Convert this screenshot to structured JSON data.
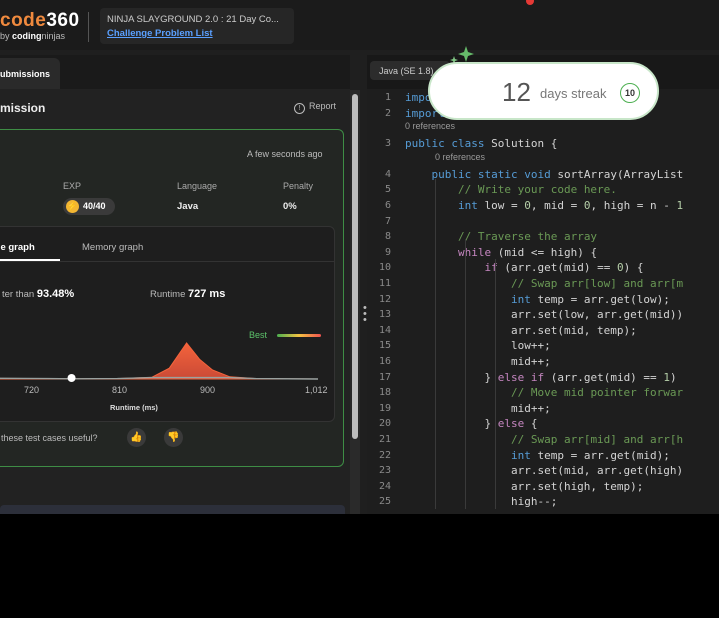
{
  "header": {
    "logo_brand": "code",
    "logo_number": "360",
    "logo_by": "by",
    "logo_company_a": "coding",
    "logo_company_b": "ninjas",
    "event_title": "NINJA SLAYGROUND 2.0 : 21 Day Co...",
    "event_link": "Challenge Problem List"
  },
  "left": {
    "tab_label": "ubmissions",
    "section_title": "mission",
    "report_label": "Report",
    "timestamp": "A few seconds ago",
    "stats": {
      "exp_label": "EXP",
      "exp_value": "40/40",
      "language_label": "Language",
      "language_value": "Java",
      "penalty_label": "Penalty",
      "penalty_value": "0%"
    },
    "graph_tabs": [
      "me graph",
      "Memory graph"
    ],
    "beats_text": "ter than",
    "beats_value": "93.48%",
    "runtime_text": "Runtime",
    "runtime_value": "727 ms",
    "best_label": "Best",
    "useful_text": "these test cases useful?"
  },
  "chart_data": {
    "type": "area",
    "xlabel": "Runtime (ms)",
    "x_ticks": [
      "720",
      "810",
      "900",
      "1,012"
    ],
    "user_runtime_ms": 727,
    "curve": {
      "x": [
        635,
        700,
        727,
        780,
        820,
        840,
        860,
        875,
        890,
        910,
        940,
        1012
      ],
      "y": [
        0.02,
        0.01,
        0.005,
        0.01,
        0.05,
        0.3,
        1.0,
        0.55,
        0.25,
        0.06,
        0.01,
        0.0
      ]
    },
    "legend": "Best"
  },
  "editor": {
    "language": "Java (SE 1.8)",
    "refs_label": "0 references",
    "lines": [
      "import",
      "import",
      "public class Solution {",
      "    public static void sortArray(ArrayList",
      "        // Write your code here.",
      "        int low = 0, mid = 0, high = n - 1",
      "",
      "        // Traverse the array",
      "        while (mid <= high) {",
      "            if (arr.get(mid) == 0) {",
      "                // Swap arr[low] and arr[m",
      "                int temp = arr.get(low);",
      "                arr.set(low, arr.get(mid))",
      "                arr.set(mid, temp);",
      "                low++;",
      "                mid++;",
      "            } else if (arr.get(mid) == 1)",
      "                // Move mid pointer forwar",
      "                mid++;",
      "            } else {",
      "                // Swap arr[mid] and arr[h",
      "                int temp = arr.get(mid);",
      "                arr.set(mid, arr.get(high)",
      "                arr.set(high, temp);",
      "                high--;"
    ]
  },
  "streak": {
    "days": "12",
    "label": "days streak",
    "badge": "10"
  },
  "colors": {
    "accent_green": "#3e8d45",
    "link_blue": "#5aa0ff",
    "peak_orange": "#f4643c"
  }
}
